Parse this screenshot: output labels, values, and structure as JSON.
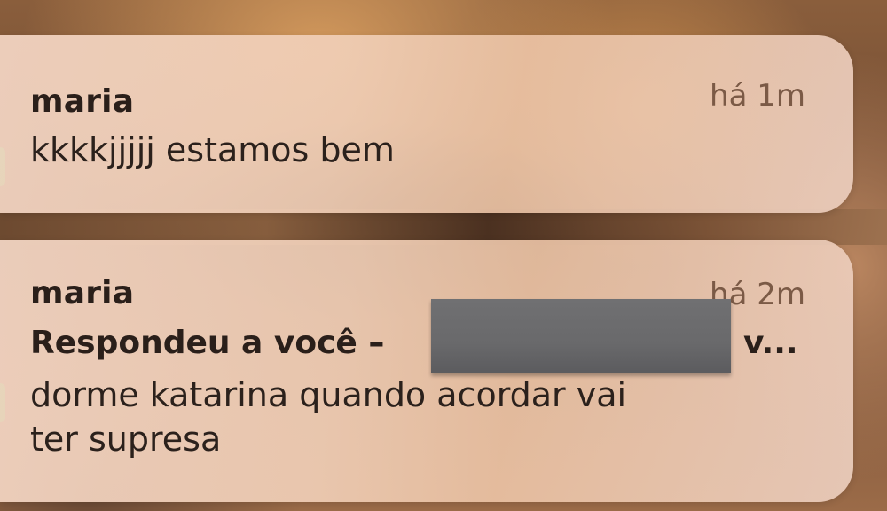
{
  "notifications": [
    {
      "sender": "maria",
      "time": "há 1m",
      "message": "kkkkjjjjj estamos bem"
    },
    {
      "sender": "maria",
      "time": "há 2m",
      "reply_prefix": "Respondeu a você –",
      "reply_suffix": "v...",
      "message_line1": "dorme katarina quando acordar vai",
      "message_line2": "ter supresa"
    }
  ],
  "colors": {
    "app_badge": "#3fcb4e",
    "redaction": "#69696b"
  }
}
